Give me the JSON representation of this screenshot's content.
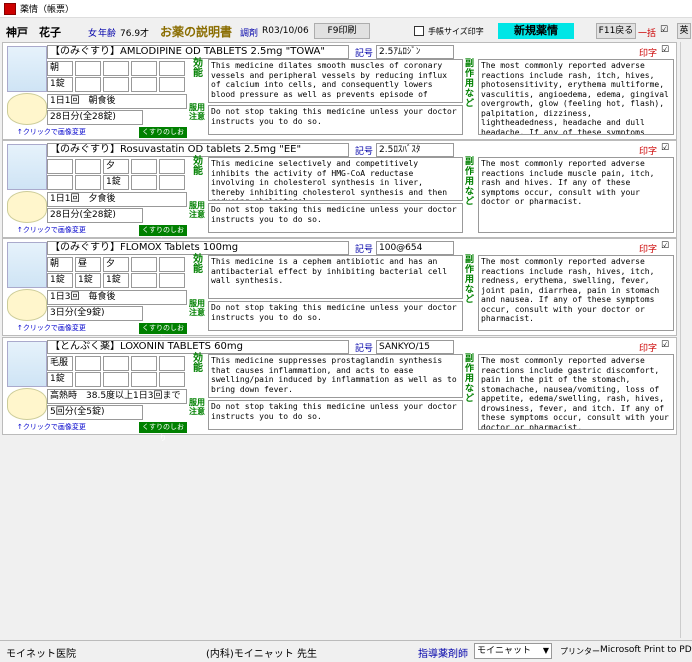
{
  "window": {
    "title": "薬情（帳票）"
  },
  "header": {
    "patient_name": "神戸　花子",
    "sex": "女",
    "age_label": "年齢",
    "age": "76.9才",
    "doc_title": "お薬の説明書",
    "rx_label": "調剤",
    "rx_date": "R03/10/06",
    "print_button": "F9印刷",
    "notebook_label": "手帳サイズ印字",
    "new_info_label": "新規薬情",
    "back_button": "F11戻る",
    "bulk_label": "一括",
    "bulk_checked": "☑",
    "lang_button": "英"
  },
  "labels": {
    "code": "記号",
    "print": "印字",
    "efficacy": "効能",
    "precautions": "服用注意",
    "side_effects": "副作用など",
    "click_image": "↑クリックで画像変更",
    "drug_booklet": "くすりのしおり"
  },
  "drugs": [
    {
      "name": "【のみぐすり】AMLODIPINE OD TABLETS 2.5mg \"TOWA\"",
      "code": "2.5ｱﾑﾛｼﾞﾝ",
      "print_checked": "☑",
      "dose": {
        "r1": [
          "朝",
          "",
          "",
          "",
          ""
        ],
        "r2": [
          "1錠",
          "",
          "",
          "",
          ""
        ]
      },
      "frequency": "1日1回　朝食後",
      "days": "28日分(全28錠)",
      "efficacy": "This medicine dilates smooth muscles of coronary vessels and peripheral vessels by reducing influx of calcium into cells, and consequently lowers blood pressure as well as prevents episode of",
      "precautions": "Do not stop taking this medicine unless your doctor instructs you to do so.",
      "side_effects": "The most commonly reported adverse reactions include rash, itch, hives, photosensitivity, erythema multiforme, vasculitis, angioedema, edema, gingival overgrowth, glow (feeling hot, flash), palpitation, dizziness, lightheadedness, headache and dull headache. If any of these symptoms"
    },
    {
      "name": "【のみぐすり】Rosuvastatin OD tablets 2.5mg \"EE\"",
      "code": "2.5ﾛｽﾊﾞｽﾀ",
      "print_checked": "☑",
      "dose": {
        "r1": [
          "",
          "",
          "夕",
          "",
          ""
        ],
        "r2": [
          "",
          "",
          "1錠",
          "",
          ""
        ]
      },
      "frequency": "1日1回　夕食後",
      "days": "28日分(全28錠)",
      "efficacy": "This medicine selectively and competitively inhibits the activity of HMG-CoA reductase involving in cholesterol synthesis in liver, thereby inhibiting cholesterol synthesis and then reducing cholesterol",
      "precautions": "Do not stop taking this medicine unless your doctor instructs you to do so.",
      "side_effects": "The most commonly reported adverse reactions include muscle pain, itch, rash and hives. If any of these symptoms occur, consult with your doctor or pharmacist."
    },
    {
      "name": "【のみぐすり】FLOMOX Tablets 100mg",
      "code": "100@654",
      "print_checked": "☑",
      "dose": {
        "r1": [
          "朝",
          "昼",
          "夕",
          "",
          ""
        ],
        "r2": [
          "1錠",
          "1錠",
          "1錠",
          "",
          ""
        ]
      },
      "frequency": "1日3回　毎食後",
      "days": "3日分(全9錠)",
      "efficacy": "This medicine is a cephem antibiotic and has an antibacterial effect by inhibiting bacterial cell wall synthesis.",
      "precautions": "Do not stop taking this medicine unless your doctor instructs you to do so.",
      "side_effects": "The most commonly reported adverse reactions include rash, hives, itch, redness, erythema, swelling, fever, joint pain, diarrhea, pain in stomach and nausea. If any of these symptoms occur, consult with your doctor or pharmacist."
    },
    {
      "name": "【とんぷく薬】LOXONIN TABLETS 60mg",
      "code": "SANKYO/15",
      "print_checked": "☑",
      "dose": {
        "r1": [
          "毛服",
          "",
          "",
          "",
          ""
        ],
        "r2": [
          "1錠",
          "",
          "",
          "",
          ""
        ]
      },
      "frequency": "高熱時　38.5度以上1日3回まで",
      "days": "5回分(全5錠)",
      "efficacy": "This medicine suppresses prostaglandin synthesis that causes inflammation, and acts to ease swelling/pain induced by inflammation as well as to bring down fever.",
      "precautions": "Do not stop taking this medicine unless your doctor instructs you to do so.",
      "side_effects": "The most commonly reported adverse reactions include gastric discomfort, pain in the pit of the stomach, stomachache, nausea/vomiting, loss of appetite, edema/swelling, rash, hives, drowsiness, fever, and itch. If any of these symptoms occur, consult with your doctor or pharmacist."
    }
  ],
  "footer": {
    "clinic": "モイネット医院",
    "doctor": "(内科)モイニャット 先生",
    "pharmacist_label": "指導薬剤師",
    "pharmacist": "モイニャット",
    "printer_label": "プリンター",
    "printer": "Microsoft Print to PDF"
  }
}
